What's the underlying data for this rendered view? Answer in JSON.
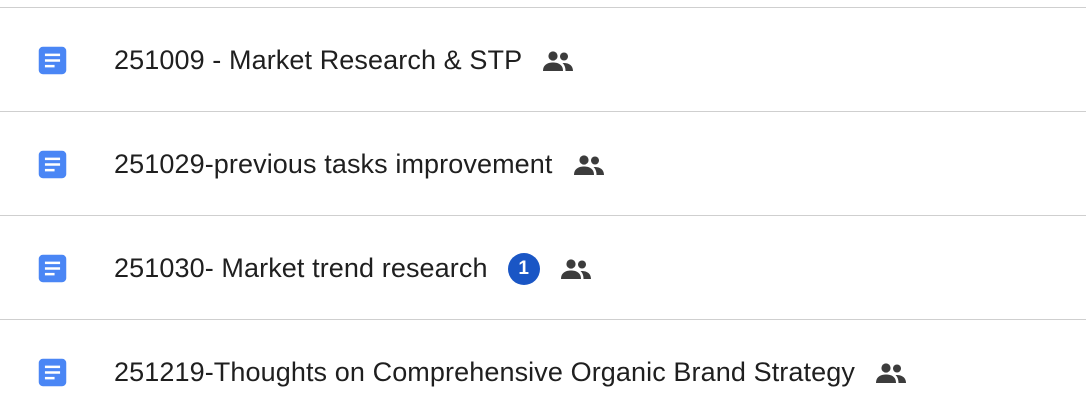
{
  "colors": {
    "doc_icon": "#4A86F5",
    "badge": "#1A56C5",
    "text": "#1F1F1F",
    "shared_icon": "#3C3C3C",
    "divider": "#CFCFCF"
  },
  "files": [
    {
      "name": "251009 - Market Research & STP",
      "icon": "google-docs-icon",
      "shared": true,
      "shared_icon": "people-icon"
    },
    {
      "name": "251029-previous tasks improvement",
      "icon": "google-docs-icon",
      "shared": true,
      "shared_icon": "people-icon"
    },
    {
      "name": "251030- Market trend research",
      "icon": "google-docs-icon",
      "badge": "1",
      "shared": true,
      "shared_icon": "people-icon"
    },
    {
      "name": "251219-Thoughts on Comprehensive Organic Brand Strategy",
      "icon": "google-docs-icon",
      "shared": true,
      "shared_icon": "people-icon"
    }
  ]
}
